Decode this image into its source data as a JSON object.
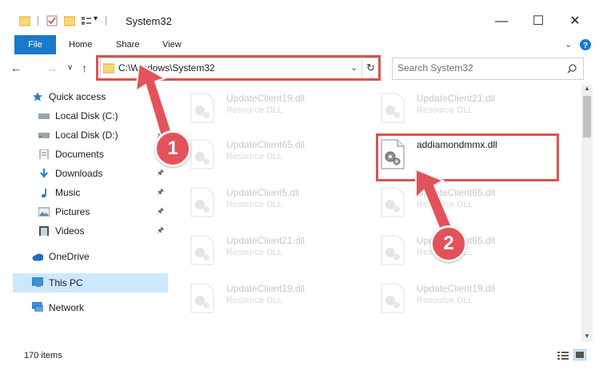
{
  "window": {
    "title": "System32"
  },
  "ribbon": {
    "tabs": [
      "File",
      "Home",
      "Share",
      "View"
    ]
  },
  "address": {
    "path": "C:\\Windows\\System32",
    "search_placeholder": "Search System32"
  },
  "sidebar": {
    "items": [
      {
        "label": "Quick access",
        "icon": "star-icon"
      },
      {
        "label": "Local Disk (C:)",
        "icon": "drive-icon"
      },
      {
        "label": "Local Disk (D:)",
        "icon": "drive-icon"
      },
      {
        "label": "Documents",
        "icon": "documents-icon"
      },
      {
        "label": "Downloads",
        "icon": "download-icon"
      },
      {
        "label": "Music",
        "icon": "music-icon"
      },
      {
        "label": "Pictures",
        "icon": "pictures-icon"
      },
      {
        "label": "Videos",
        "icon": "videos-icon"
      },
      {
        "label": "OneDrive",
        "icon": "cloud-icon"
      },
      {
        "label": "This PC",
        "icon": "computer-icon"
      },
      {
        "label": "Network",
        "icon": "network-icon"
      }
    ]
  },
  "files": [
    {
      "name": "UpdateClient19.dll",
      "type": "Resource DLL"
    },
    {
      "name": "UpdateClient21.dll",
      "type": "Resource DLL"
    },
    {
      "name": "UpdateClient65.dll",
      "type": "Resource DLL"
    },
    {
      "name": "addiamondmmx.dll",
      "type": ""
    },
    {
      "name": "UpdateClient5.dll",
      "type": "Resource DLL"
    },
    {
      "name": "UpdateClient65.dll",
      "type": "Resource DLL"
    },
    {
      "name": "UpdateClient21.dll",
      "type": "Resource DLL"
    },
    {
      "name": "UpdateClient65.dll",
      "type": "Resource DLL"
    },
    {
      "name": "UpdateClient19.dll",
      "type": "Resource DLL"
    },
    {
      "name": "UpdateClient19.dll",
      "type": "Resource DLL"
    }
  ],
  "status": {
    "item_count": "170 items"
  },
  "annotations": {
    "step1": "1",
    "step2": "2"
  },
  "colors": {
    "accent": "#1979ca",
    "highlight": "#d9534f",
    "selected": "#cce8ff"
  }
}
